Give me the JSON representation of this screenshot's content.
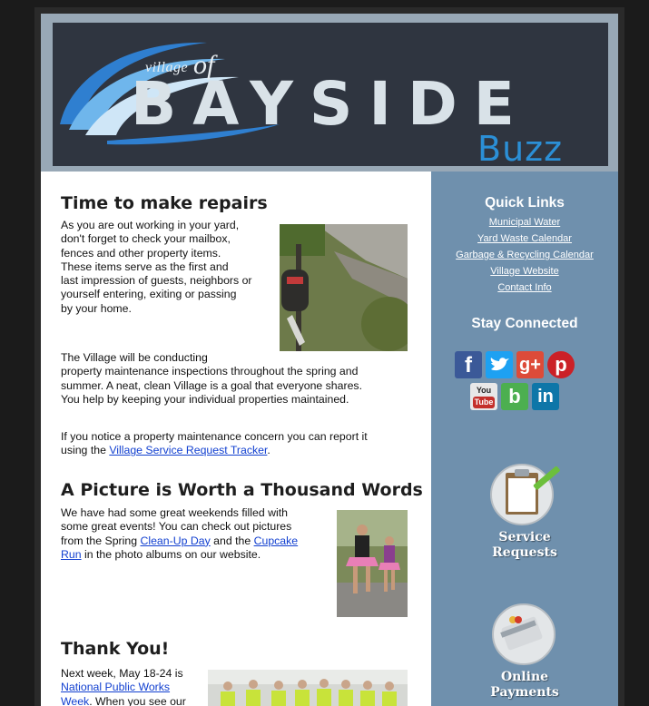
{
  "header": {
    "village": "village",
    "of": "of",
    "name": "BAYSIDE",
    "buzz": "Buzz"
  },
  "article1": {
    "title": "Time to make repairs",
    "lines": [
      "As you are out working in your yard,",
      "don't forget to check your mailbox,",
      "fences and other property items.",
      "These items serve as the first and",
      "last impression of guests, neighbors or",
      "yourself entering, exiting or passing",
      "by your home."
    ],
    "para2": [
      "The Village will be conducting",
      "property maintenance inspections throughout the spring and",
      "summer. A neat, clean Village is a goal that everyone shares.",
      "You help by keeping your individual properties maintained."
    ],
    "para3_line1": "If you notice a property maintenance concern you can report it",
    "para3_pre": "using the ",
    "para3_link": "Village Service Request Tracker",
    "para3_post": "."
  },
  "article2": {
    "title": "A Picture is Worth a Thousand Words",
    "lines": [
      "We have had some great weekends filled with",
      "some great events! You can check out pictures"
    ],
    "line3_pre": "from the Spring ",
    "link1": "Clean-Up Day",
    "line3_mid": " and the ",
    "link2": "Cupcake",
    "link2b": "Run",
    "line4_post": " in the photo albums on our website."
  },
  "article3": {
    "title": "Thank You!",
    "line1": "Next week, May 18-24  is",
    "link1": "National Public Works",
    "link1b": "Week",
    "line3_post": ". When you see our"
  },
  "sidebar": {
    "quick_links_title": "Quick Links",
    "links": [
      "Municipal Water",
      "Yard Waste Calendar",
      "Garbage & Recycling Calendar",
      "Village Website",
      "Contact Info"
    ],
    "stay_connected_title": "Stay Connected",
    "social": {
      "facebook": "f",
      "twitter": "t",
      "googleplus": "g+",
      "pinterest": "p",
      "youtube_top": "You",
      "youtube_bottom": "Tube",
      "blog": "b",
      "linkedin": "in"
    },
    "service_line1": "Service",
    "service_line2": "Requests",
    "payments_line1": "Online",
    "payments_line2": "Payments"
  },
  "colors": {
    "sidebar": "#6f90ad",
    "header_frame": "#98a8b6",
    "link": "#1240d0",
    "facebook": "#3b5998",
    "twitter": "#1da1f2",
    "googleplus": "#dd4b39",
    "pinterest": "#cb2027",
    "youtube": "#c4302b",
    "blog": "#4caf50",
    "linkedin": "#0e76a8"
  }
}
